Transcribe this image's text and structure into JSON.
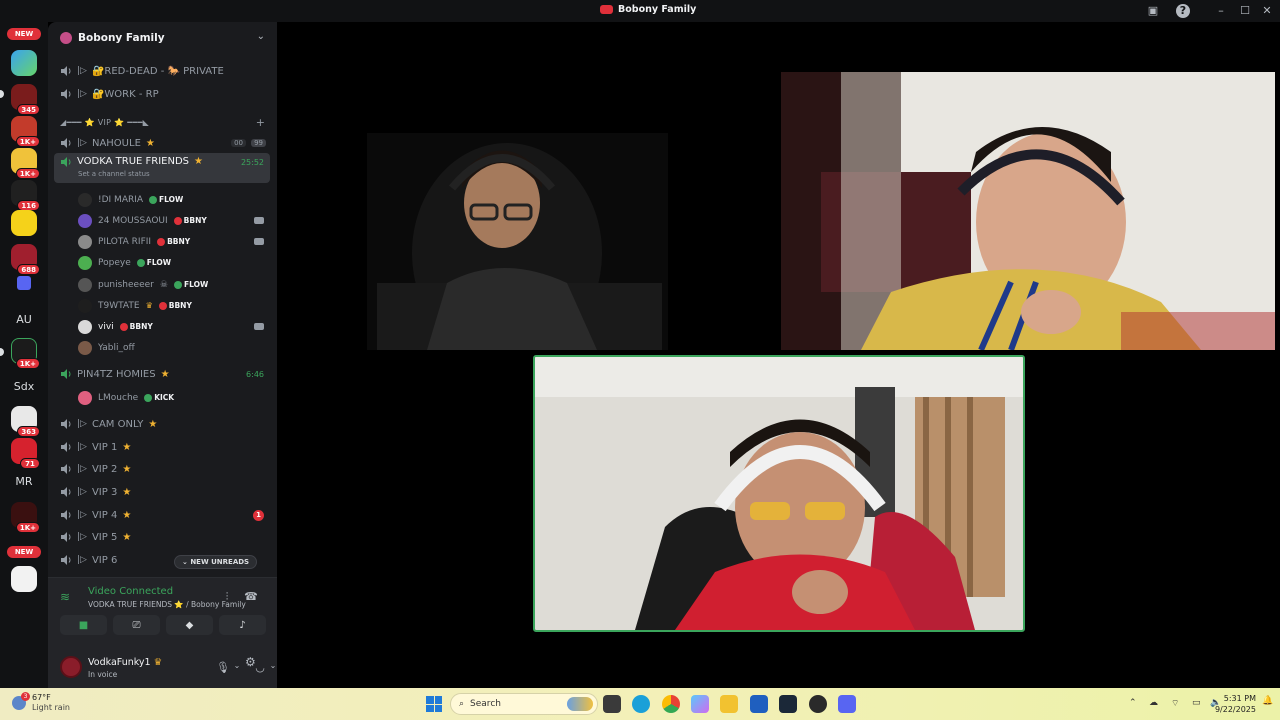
{
  "window": {
    "title": "Bobony Family"
  },
  "rail": {
    "new_top": "NEW",
    "new_bottom": "NEW",
    "badges": [
      "345",
      "1K+",
      "1K+",
      "116",
      "688",
      "1K+",
      "363",
      "71",
      "1K+"
    ],
    "text_servers": [
      "AU",
      "Sdx",
      "MR"
    ]
  },
  "guild": {
    "name": "Bobony Family"
  },
  "channels": {
    "red_dead": "🔐RED-DEAD - 🐎 PRIVATE",
    "work_rp": "🔐WORK - RP",
    "vip_category": "◢━━━ ⭐ VIP ⭐ ━━━◣",
    "nahoule": "NAHOULE",
    "nahoule_count_a": "00",
    "nahoule_count_b": "99",
    "vodka": "VODKA TRUE FRIENDS",
    "vodka_timer": "25:52",
    "vodka_status": "Set a channel status",
    "pin4tz": "PIN4TZ HOMIES",
    "pin4tz_timer": "6:46",
    "cam_only": "CAM ONLY",
    "vip1": "VIP 1",
    "vip2": "VIP 2",
    "vip3": "VIP 3",
    "vip4": "VIP 4",
    "vip4_badge": "1",
    "vip5": "VIP 5",
    "vip6": "VIP 6",
    "new_unreads": "NEW UNREADS"
  },
  "members": [
    {
      "name": "!DI MARIA",
      "tag": "FLOW",
      "color": "#3ba55c"
    },
    {
      "name": "24 MOUSSAOUI",
      "tag": "BBNY",
      "color": "#e0313a"
    },
    {
      "name": "PILOTA RIFII",
      "tag": "BBNY",
      "color": "#e0313a"
    },
    {
      "name": "Popeye",
      "tag": "FLOW",
      "color": "#3ba55c"
    },
    {
      "name": "punisheeeer",
      "tag": "FLOW",
      "color": "#3ba55c"
    },
    {
      "name": "T9WTATE",
      "tag": "BBNY",
      "color": "#e0313a"
    },
    {
      "name": "vivi",
      "tag": "BBNY",
      "color": "#e0313a"
    },
    {
      "name": "Yabli_off",
      "tag": "",
      "color": ""
    },
    {
      "name": "LMouche",
      "tag": "KICK",
      "color": "#3ba55c"
    }
  ],
  "voice": {
    "status": "Video Connected",
    "location": "VODKA TRUE FRIENDS ⭐ / Bobony Family"
  },
  "user": {
    "name": "VodkaFunky1",
    "status": "In voice"
  },
  "taskbar": {
    "weather_temp": "67°F",
    "weather_desc": "Light rain",
    "weather_badge": "3",
    "search_placeholder": "Search",
    "time": "5:31 PM",
    "date": "9/22/2025"
  },
  "colors": {
    "accent_green": "#3ba55c",
    "alert_red": "#e0313a",
    "star": "#f0b232"
  }
}
